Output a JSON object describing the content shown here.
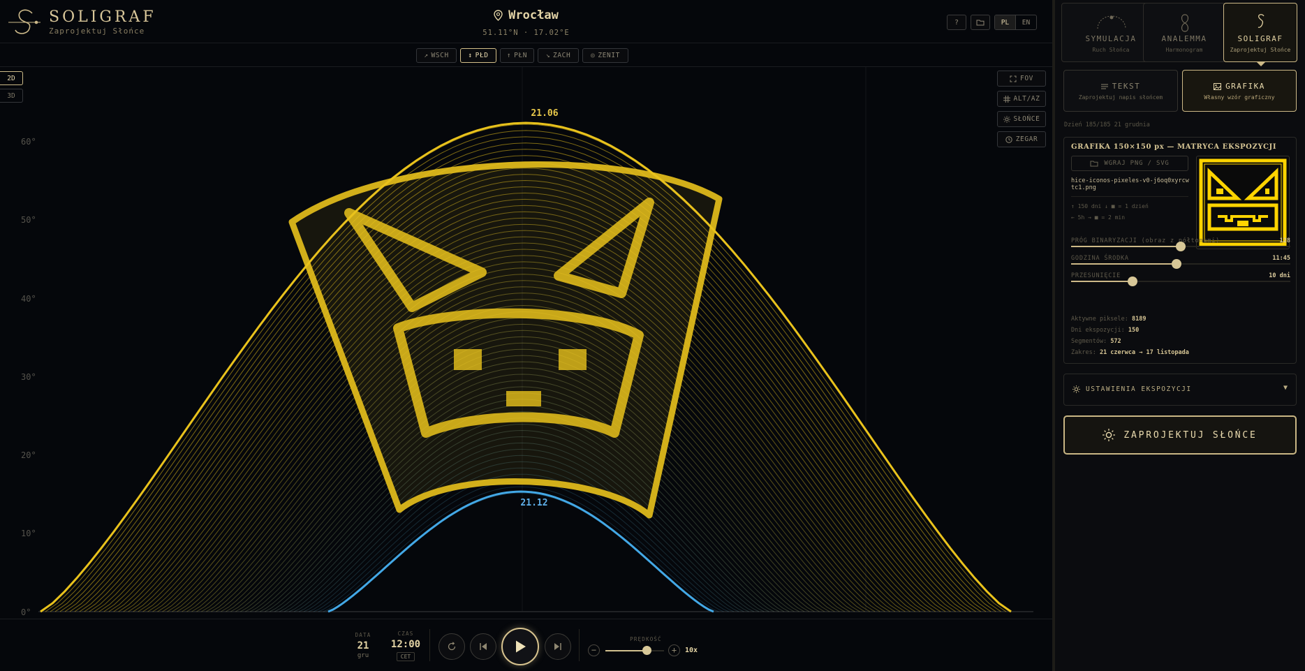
{
  "brand": {
    "name": "SOLIGRAF",
    "subtitle": "Zaprojektuj Słońce"
  },
  "location": {
    "name": "Wrocław",
    "coords": "51.11°N · 17.02°E"
  },
  "header_buttons": {
    "help": "?",
    "folder_icon": "folder-icon",
    "languages": [
      "PL",
      "EN"
    ],
    "active_language": "PL"
  },
  "directions": [
    {
      "label": "WSCH",
      "icon": "↗",
      "active": false
    },
    {
      "label": "PŁD",
      "icon": "↕",
      "active": true
    },
    {
      "label": "PŁN",
      "icon": "↑",
      "active": false
    },
    {
      "label": "ZACH",
      "icon": "↘",
      "active": false
    },
    {
      "label": "ZENIT",
      "icon": "◎",
      "active": false
    }
  ],
  "view_modes": {
    "mode_2d": "2D",
    "mode_3d": "3D",
    "active": "2D"
  },
  "overlay_toggles": {
    "fov": "FOV",
    "altaz": "ALT/AZ",
    "sun": "SŁOŃCE",
    "clock": "ZEGAR"
  },
  "chart": {
    "y_ticks": [
      "60°",
      "50°",
      "40°",
      "30°",
      "20°",
      "10°",
      "0°"
    ],
    "summer_label": "21.06",
    "winter_label": "21.12",
    "colors": {
      "summer": "#e9c21c",
      "winter": "#43a8e6"
    }
  },
  "playback": {
    "date_label": "DATA",
    "date_day": "21",
    "date_month": "gru",
    "time_label": "CZAS",
    "time_value": "12:00",
    "timezone": "CET",
    "speed_label": "PRĘDKOŚĆ",
    "speed_value": "10x",
    "speed_level": 0.7
  },
  "panel": {
    "modes": [
      {
        "title": "SYMULACJA",
        "sub": "Ruch Słońca",
        "active": false
      },
      {
        "title": "ANALEMMA",
        "sub": "Harmonogram",
        "active": false
      },
      {
        "title": "SOLIGRAF",
        "sub": "Zaprojektuj Słońce",
        "active": true
      }
    ],
    "submodes": [
      {
        "title": "TEKST",
        "sub": "Zaprojektuj napis słońcem",
        "active": false
      },
      {
        "title": "GRAFIKA",
        "sub": "Własny wzór graficzny",
        "active": true
      }
    ],
    "day_info": "Dzień 185/185 21 grudnia",
    "graphic": {
      "title": "GRAFIKA 150×150 px — MATRYCA EKSPOZYCJI",
      "load_button": "WGRAJ PNG / SVG",
      "filename": "hice-iconos-pixeles-v0-j6oq0xyrcwtc1.png",
      "legend_1": "↑ 150 dni ↓  ■ = 1 dzień",
      "legend_2": "← 5h →  ■ = 2 min"
    },
    "sliders": [
      {
        "label": "PRÓG BINARYZACJI (obraz z półtonami)",
        "value": "128",
        "level": 0.5
      },
      {
        "label": "GODZINA ŚRODKA",
        "value": "11:45",
        "level": 0.48
      },
      {
        "label": "PRZESUNIĘCIE",
        "value": "10 dni",
        "level": 0.28
      }
    ],
    "stats": [
      {
        "label": "Aktywne piksele:",
        "value": "8189"
      },
      {
        "label": "Dni ekspozycji:",
        "value": "150"
      },
      {
        "label": "Segmentów:",
        "value": "572"
      },
      {
        "label": "Zakres:",
        "value": "21 czerwca → 17 listopada"
      }
    ],
    "exposure_settings": "USTAWIENIA EKSPOZYCJI",
    "design_button": "ZAPROJEKTUJ SŁOŃCE"
  }
}
